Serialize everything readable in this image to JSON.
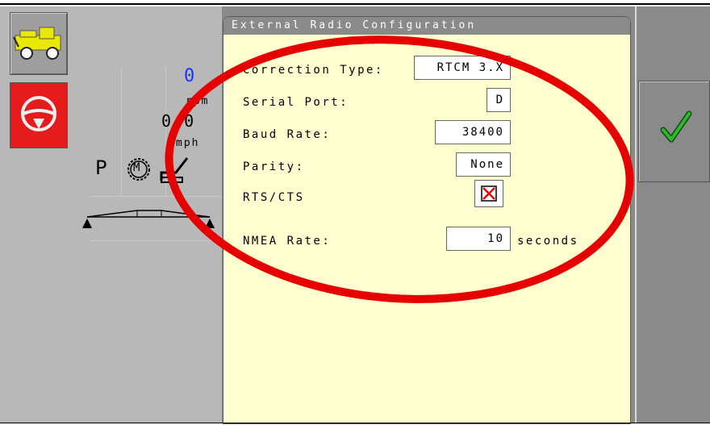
{
  "dialog": {
    "title": "External Radio Configuration"
  },
  "settings": {
    "correction_type": {
      "label": "Correction Type:",
      "value": "RTCM 3.X"
    },
    "serial_port": {
      "label": "Serial Port:",
      "value": "D"
    },
    "baud_rate": {
      "label": "Baud Rate:",
      "value": "38400"
    },
    "parity": {
      "label": "Parity:",
      "value": "None"
    },
    "rts_cts": {
      "label": "RTS/CTS",
      "checked": false,
      "icon": "x-mark-icon"
    },
    "nmea_rate": {
      "label": "NMEA Rate:",
      "value": "10",
      "unit": "seconds"
    }
  },
  "gauge": {
    "rpm_value": "0",
    "rpm_unit": "rpm",
    "speed_value": "0.0",
    "speed_unit": "mph",
    "gear": "P",
    "mode_letter": "M"
  },
  "colors": {
    "dialog_bg": "#ffffd0",
    "steer_button": "#e61b1b",
    "confirm_check": "#1a8a1a",
    "annotation_ellipse": "#e60000",
    "rpm_value": "#1a33ff"
  },
  "icons": [
    "tractor-icon",
    "steering-wheel-icon",
    "gear-icon",
    "throttle-lever-icon",
    "boom-icon",
    "checkmark-icon"
  ]
}
